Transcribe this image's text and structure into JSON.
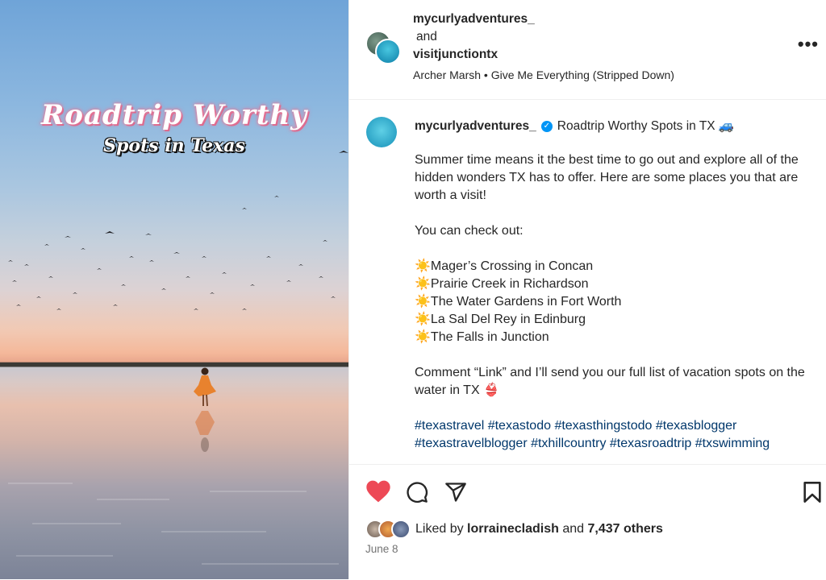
{
  "media": {
    "title_line1": "Roadtrip Worthy",
    "title_line2": "Spots in Texas"
  },
  "header": {
    "user1": "mycurlyadventures_",
    "conjunction": "and",
    "user2": "visitjunctiontx",
    "music_artist": "Archer Marsh",
    "music_separator": "•",
    "music_track": "Give Me Everything (Stripped Down)",
    "more_icon": "more-horizontal-icon"
  },
  "caption": {
    "username": "mycurlyadventures_",
    "headline": "Roadtrip Worthy Spots in TX 🚙",
    "paragraph1": "Summer time means it the best time to go out and explore all of the hidden wonders TX has to offer. Here are some places you that are worth a visit!",
    "intro": "You can check out:",
    "places": [
      "Mager’s Crossing in Concan",
      "Prairie Creek in Richardson",
      "The Water Gardens in Fort Worth",
      "La Sal Del Rey in Edinburg",
      "The Falls in Junction"
    ],
    "bullet": "☀️",
    "cta": "Comment “Link” and I’ll send you our full list of vacation spots on the water in TX 👙",
    "hashtags": "#texastravel #texastodo #texasthingstodo #texasblogger #texastravelblogger #txhillcountry #texasroadtrip #txswimming"
  },
  "actions": {
    "like_icon": "heart-filled-icon",
    "comment_icon": "comment-icon",
    "share_icon": "send-icon",
    "save_icon": "bookmark-icon",
    "like_color": "#ed4956"
  },
  "likes": {
    "prefix": "Liked by",
    "user": "lorrainecladish",
    "and": "and",
    "others": "7,437 others"
  },
  "date": "June 8"
}
